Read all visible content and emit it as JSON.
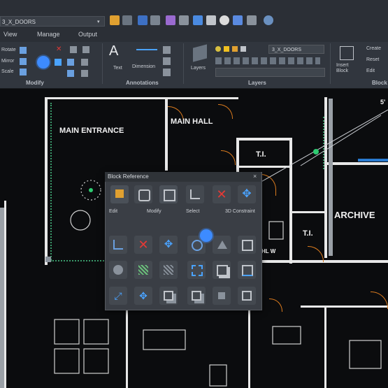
{
  "quick_access": {
    "layer_value": "3_X_DOORS",
    "icons": [
      "new-file-icon",
      "open-icon",
      "save-icon",
      "undo-icon",
      "redo-icon",
      "print-icon",
      "plot-icon",
      "zoom-icon",
      "layout-icon",
      "help-icon"
    ]
  },
  "tabs": [
    {
      "label": "View"
    },
    {
      "label": "Manage"
    },
    {
      "label": "Output"
    }
  ],
  "ribbon": {
    "modify": {
      "title": "Modify",
      "items": [
        "Rotate",
        "Mirror",
        "Scale"
      ]
    },
    "annotations": {
      "title": "Annotations",
      "text_label": "Text",
      "dimension_label": "Dimension"
    },
    "layers": {
      "title": "Layers",
      "layers_label": "Layers",
      "current_layer": "3_X_DOORS"
    },
    "block": {
      "title": "Block",
      "insert_label": "Insert Block",
      "items": [
        "Create",
        "Reset",
        "Edit"
      ]
    }
  },
  "drawing": {
    "rooms": {
      "main_entrance": "MAIN ENTRANCE",
      "main_hall": "MAIN HALL",
      "ti_top": "T.I.",
      "ti_right": "T.I.",
      "archive": "ARCHIVE",
      "dim_text": "5'",
      "hall_w": "HL W"
    }
  },
  "popup": {
    "title": "Block Reference",
    "close": "×",
    "labels": [
      "Edit",
      "Modify",
      "Select",
      "3D Constraint"
    ]
  },
  "colors": {
    "accent": "#3d8bff",
    "door": "#d97a1e",
    "wall": "#e8e8e8",
    "delete_red": "#e53935",
    "move_blue": "#4aa3ff"
  }
}
